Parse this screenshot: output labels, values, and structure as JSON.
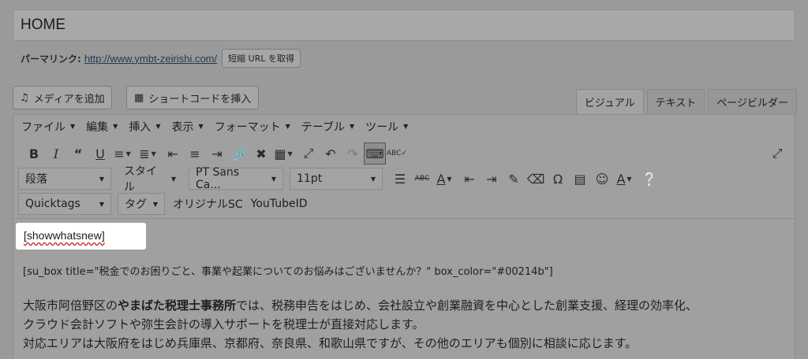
{
  "title": "HOME",
  "permalink": {
    "label": "パーマリンク:",
    "url": "http://www.ymbt-zeirishi.com/",
    "shortlink_button": "短縮 URL を取得"
  },
  "media_buttons": {
    "add_media": "メディアを追加",
    "insert_shortcode": "ショートコードを挿入"
  },
  "tabs": [
    "ビジュアル",
    "テキスト",
    "ページビルダー"
  ],
  "menubar": [
    "ファイル",
    "編集",
    "挿入",
    "表示",
    "フォーマット",
    "テーブル",
    "ツール"
  ],
  "toolbar": {
    "paragraph_select": "段落",
    "style_select": "スタイル",
    "font_select": "PT Sans Ca...",
    "size_select": "11pt",
    "quicktags_select": "Quicktags",
    "tag_select": "タグ",
    "original_sc": "オリジナルSC",
    "youtube_id": "YouTubeID"
  },
  "content": {
    "shortcode_line": "[showwhatsnew]",
    "box_line": "[su_box title=\"税金でのお困りごと、事業や起業についてのお悩みはございませんか？\" box_color=\"#00214b\"]",
    "para_pre": "大阪市阿倍野区の",
    "para_bold": "やまばた税理士事務所",
    "para_post": "では、税務申告をはじめ、会社設立や創業融資を中心とした創業支援、経理の効率化、",
    "para_line2": "クラウド会計ソフトや弥生会計の導入サポートを税理士が直接対応します。",
    "para_line3": "対応エリアは大阪府をはじめ兵庫県、京都府、奈良県、和歌山県ですが、その他のエリアも個別に相談に応じます。"
  },
  "colors": {
    "overlay": "#9a9a9a",
    "highlight": "#ffffff",
    "link": "#1c3a57"
  }
}
